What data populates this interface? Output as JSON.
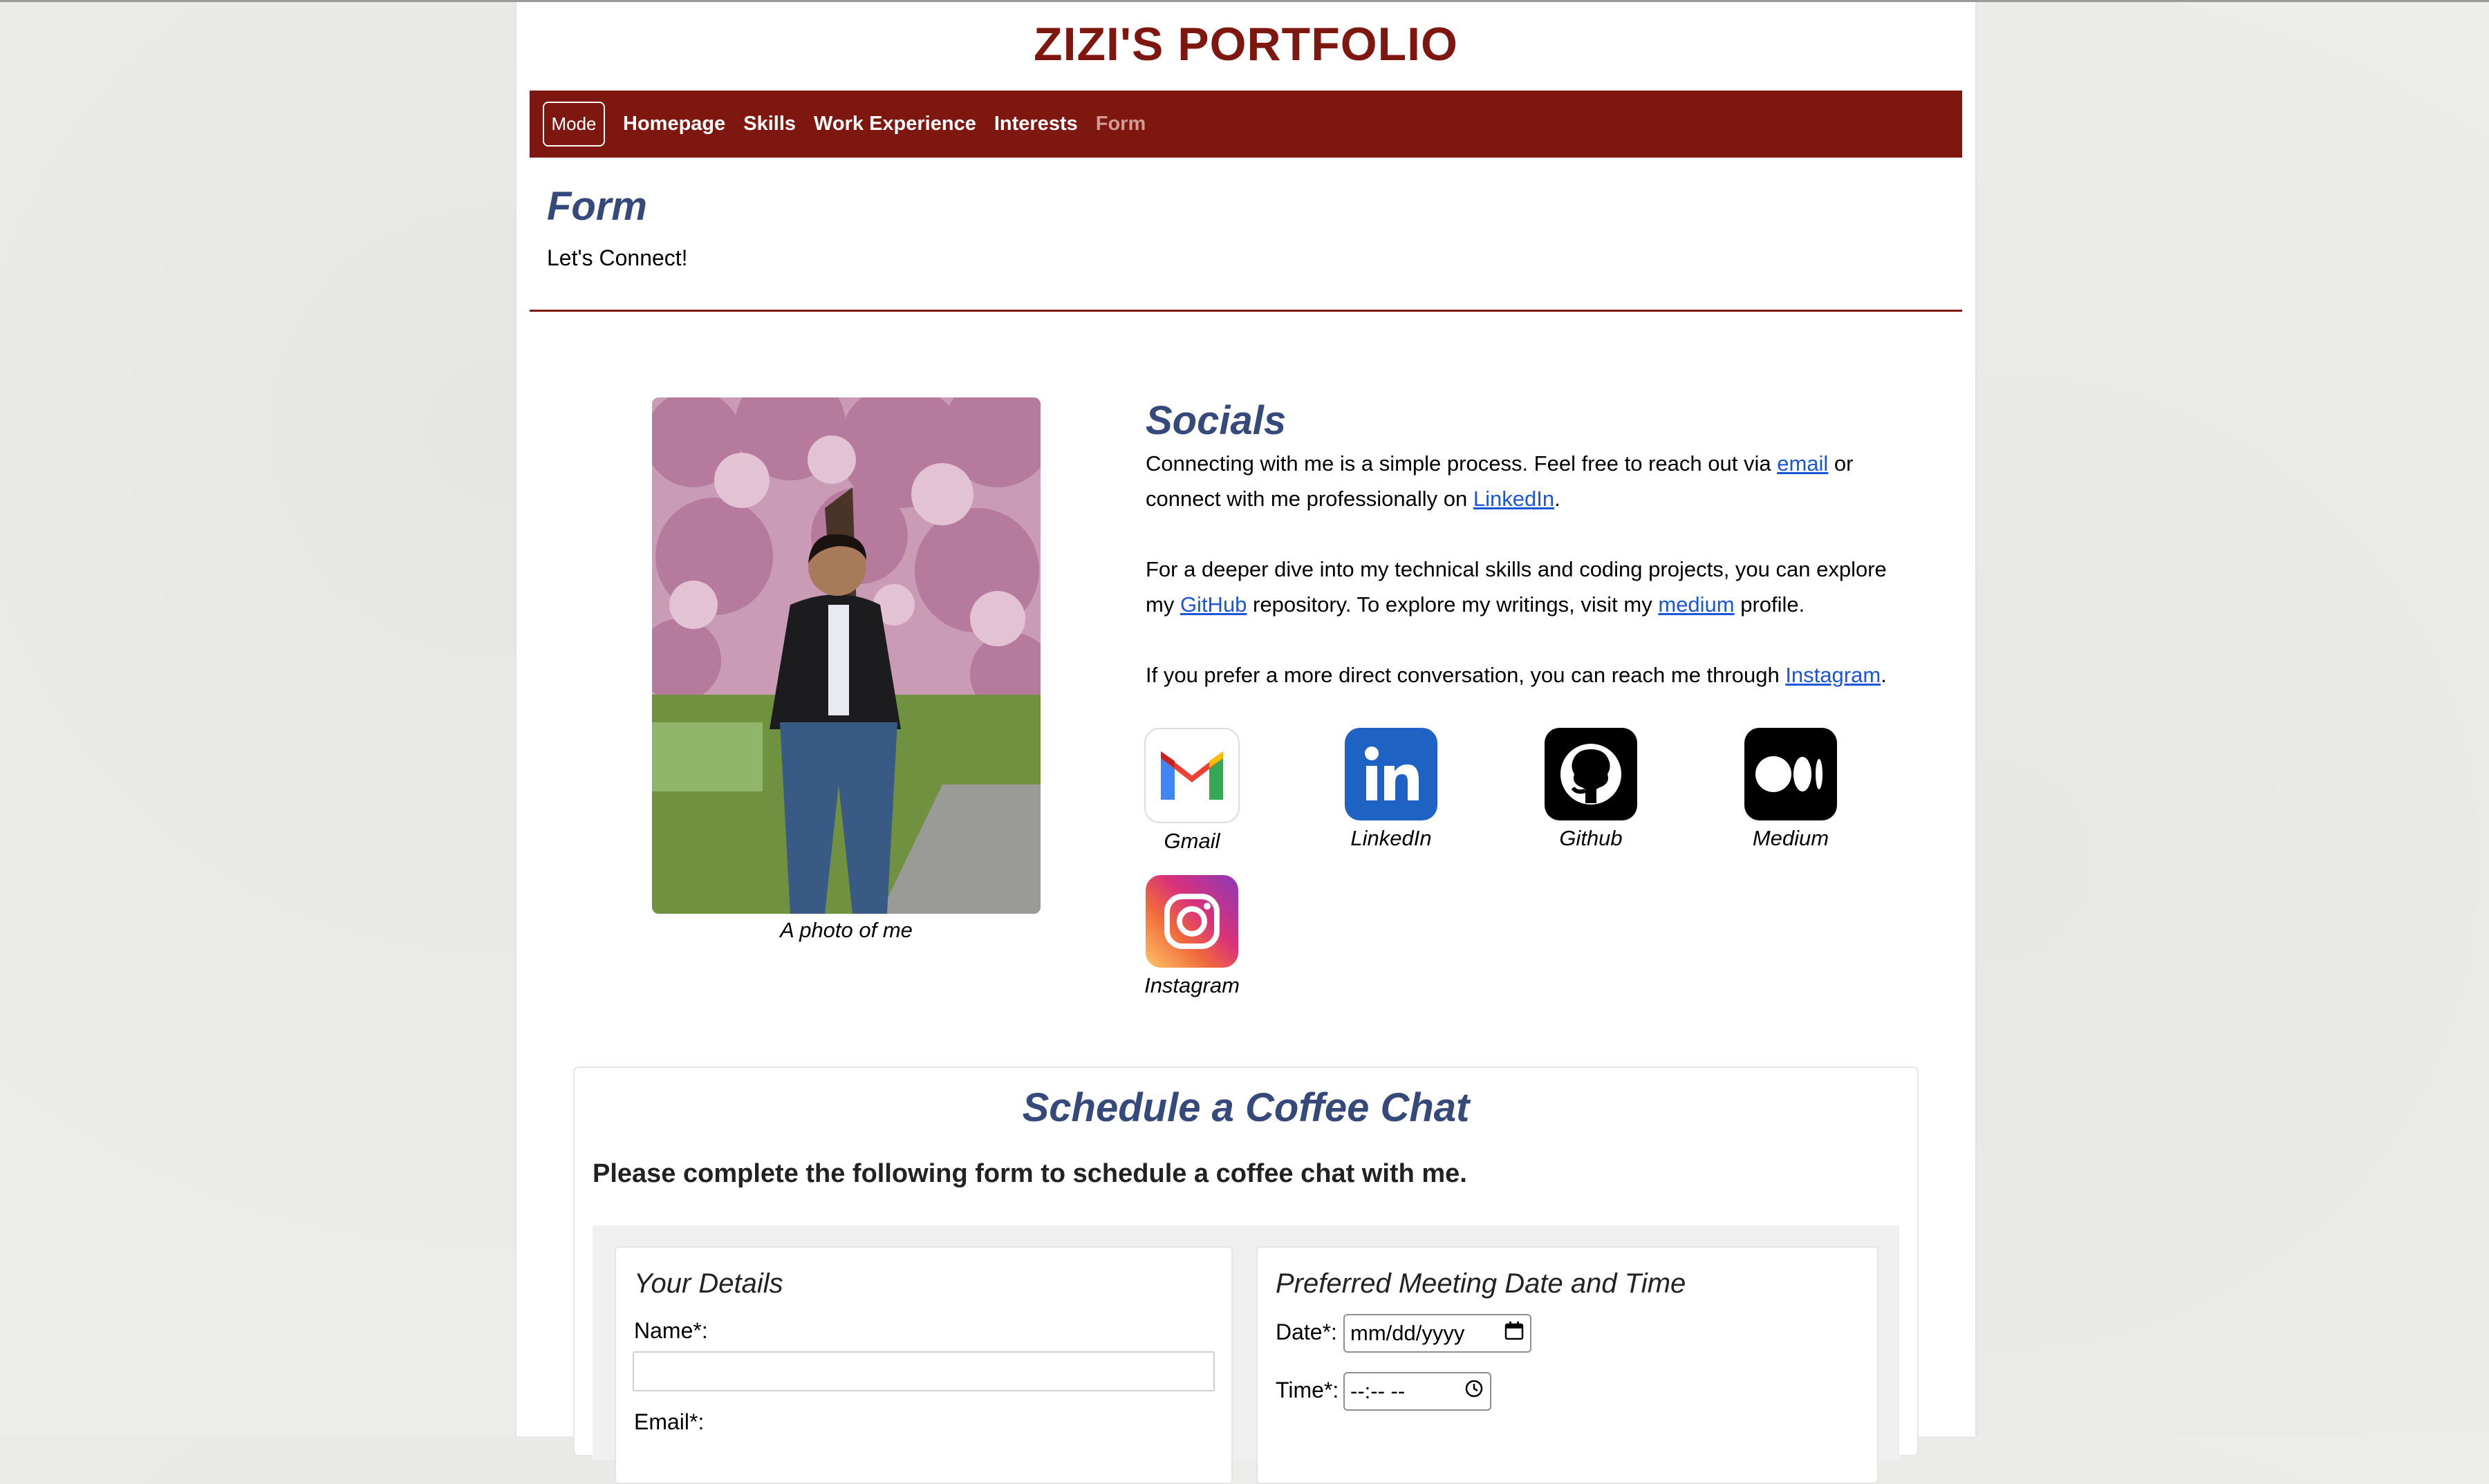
{
  "site": {
    "title": "ZIZI'S PORTFOLIO"
  },
  "nav": {
    "mode_label": "Mode",
    "items": [
      {
        "label": "Homepage"
      },
      {
        "label": "Skills"
      },
      {
        "label": "Work Experience"
      },
      {
        "label": "Interests"
      },
      {
        "label": "Form"
      }
    ],
    "active": "Form"
  },
  "header": {
    "title": "Form",
    "subtitle": "Let's Connect!"
  },
  "photo": {
    "caption": "A photo of me"
  },
  "socials": {
    "title": "Socials",
    "p1": {
      "a": "Connecting with me is a simple process. Feel free to reach out via ",
      "email": "email",
      "b": " or connect with me professionally on ",
      "linkedin": "LinkedIn",
      "c": "."
    },
    "p2": {
      "a": "For a deeper dive into my technical skills and coding projects, you can explore my ",
      "github": "GitHub",
      "b": " repository. To explore my writings, visit my ",
      "medium": "medium",
      "c": " profile."
    },
    "p3": {
      "a": "If you prefer a more direct conversation, you can reach me through ",
      "instagram": "Instagram",
      "c": "."
    },
    "icons": [
      {
        "label": "Gmail",
        "icon": "gmail-icon"
      },
      {
        "label": "LinkedIn",
        "icon": "linkedin-icon"
      },
      {
        "label": "Github",
        "icon": "github-icon"
      },
      {
        "label": "Medium",
        "icon": "medium-icon"
      },
      {
        "label": "Instagram",
        "icon": "instagram-icon"
      }
    ]
  },
  "chat": {
    "title": "Schedule a Coffee Chat",
    "subtitle": "Please complete the following form to schedule a coffee chat with me.",
    "details": {
      "title": "Your Details",
      "name_label": "Name*:",
      "email_label": "Email*:"
    },
    "meeting": {
      "title": "Preferred Meeting Date and Time",
      "date_label": "Date*:",
      "date_placeholder": "mm/dd/yyyy",
      "time_label": "Time*:",
      "time_placeholder": "--:-- --"
    }
  },
  "colors": {
    "brand": "#7e1710",
    "heading": "#35497a",
    "link": "#1a56d6"
  }
}
